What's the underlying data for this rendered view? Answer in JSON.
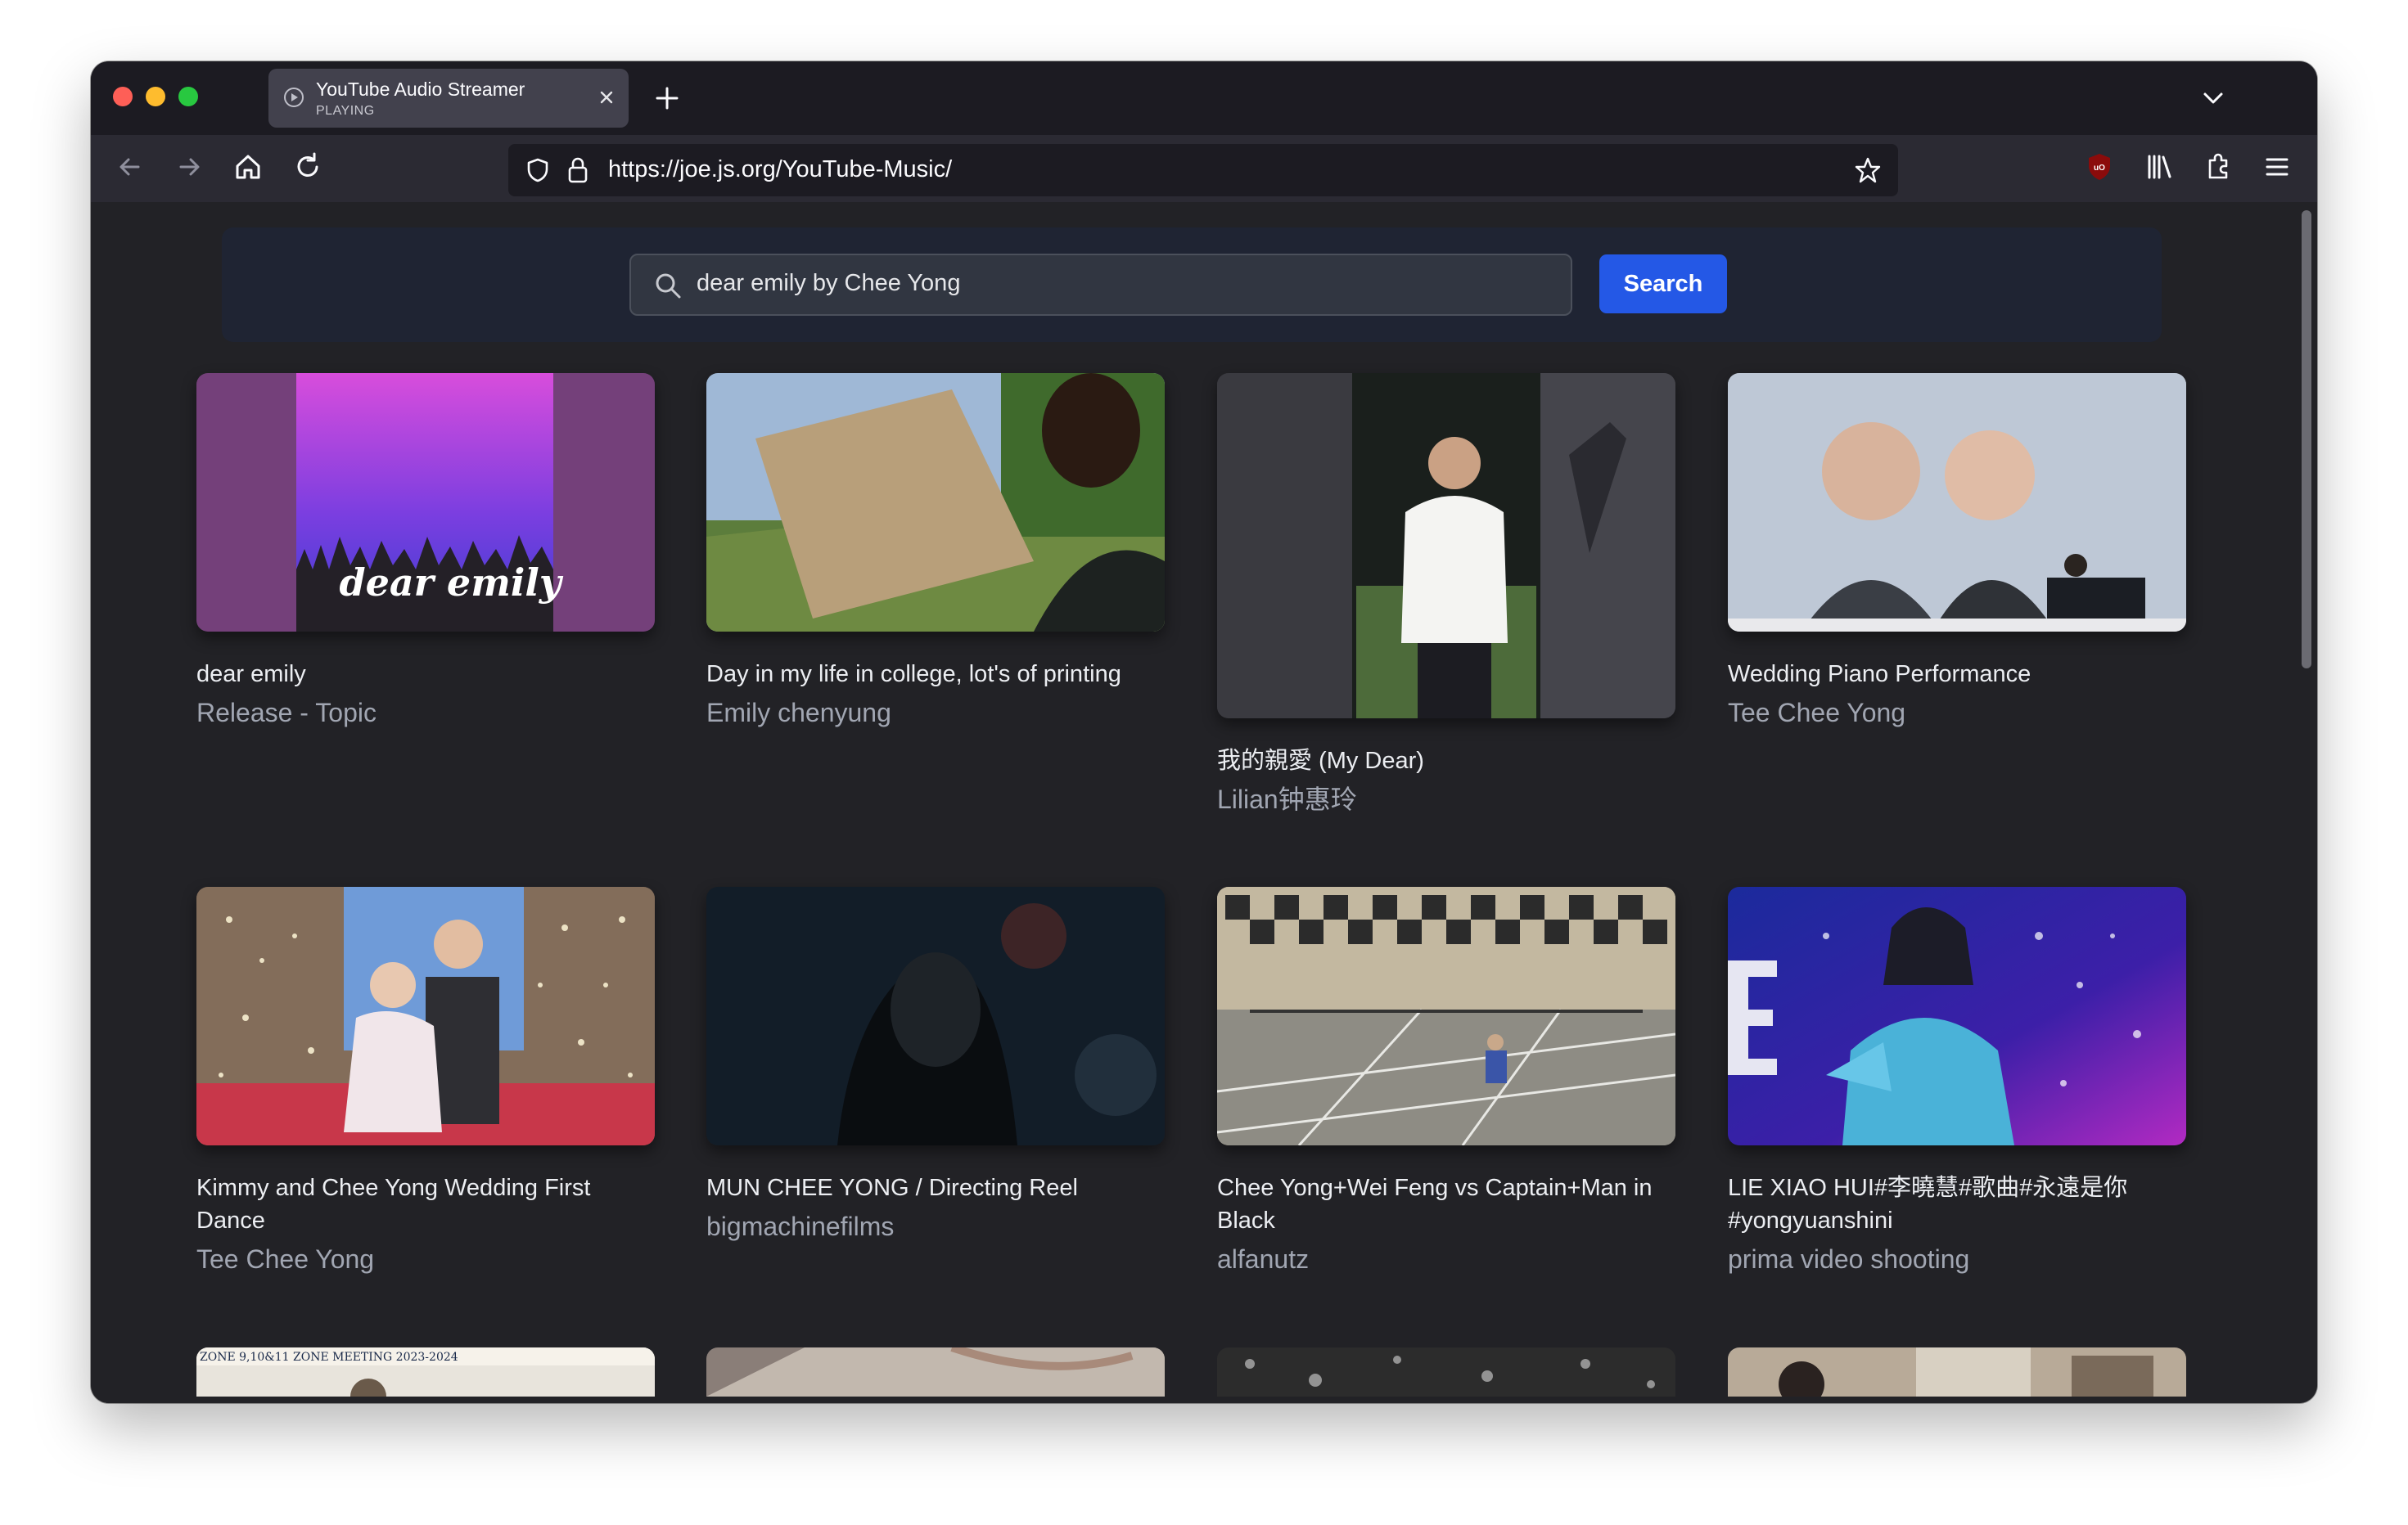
{
  "browser": {
    "tab": {
      "title": "YouTube Audio Streamer",
      "status": "PLAYING"
    },
    "url": "https://joe.js.org/YouTube-Music/"
  },
  "search": {
    "query": "dear emily by Chee Yong",
    "button_label": "Search"
  },
  "thumbnail_art": {
    "dear_emily_text": "dear emily",
    "zone_banner_text": "ZONE 9,10&11 ZONE MEETING 2023-2024"
  },
  "colors": {
    "accent": "#2458e6",
    "channel_text": "#a1a6b2",
    "background": "#222226"
  },
  "results": [
    {
      "title": "dear emily",
      "channel": "Release - Topic"
    },
    {
      "title": "Day in my life in college, lot's of printing",
      "channel": "Emily chenyung"
    },
    {
      "title": "我的親愛 (My Dear)",
      "channel": "Lilian钟惠玲"
    },
    {
      "title": "Wedding Piano Performance",
      "channel": "Tee Chee Yong"
    },
    {
      "title": "Kimmy and Chee Yong Wedding First Dance",
      "channel": "Tee Chee Yong"
    },
    {
      "title": "MUN CHEE YONG / Directing Reel",
      "channel": "bigmachinefilms"
    },
    {
      "title": "Chee Yong+Wei Feng vs Captain+Man in Black",
      "channel": "alfanutz"
    },
    {
      "title": "LIE XIAO HUI#李曉慧#歌曲#永遠是你 #yongyuanshini",
      "channel": "prima video shooting"
    }
  ]
}
